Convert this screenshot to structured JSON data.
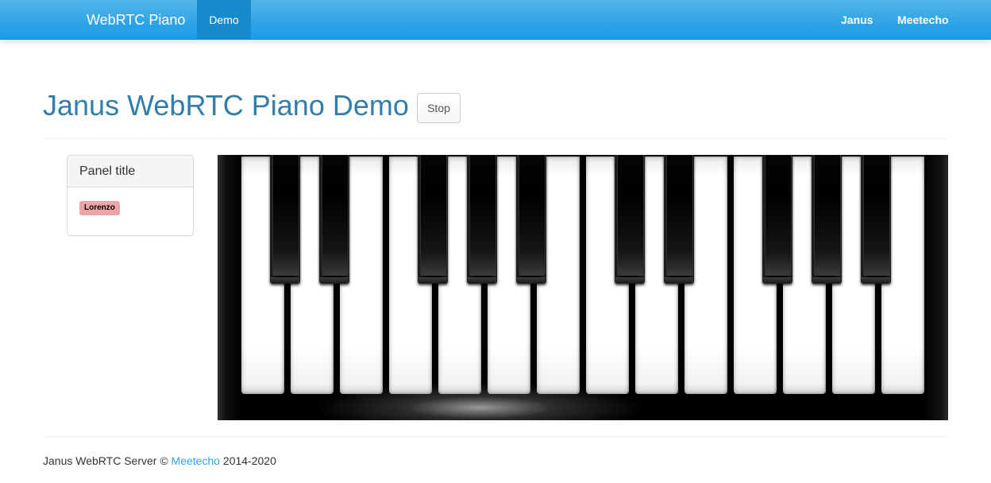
{
  "navbar": {
    "brand": "WebRTC Piano",
    "active_item": "Demo",
    "right_items": [
      "Janus",
      "Meetecho"
    ],
    "background_color": "#2fa4e7",
    "active_color": "#178acc"
  },
  "header": {
    "title": "Janus WebRTC Piano Demo",
    "stop_label": "Stop",
    "title_color": "#317eac"
  },
  "panel": {
    "title": "Panel title",
    "participants": [
      "Lorenzo"
    ],
    "participant_label_color": "#eba5a8"
  },
  "piano": {
    "white_key_count": 14,
    "black_key_count": 10
  },
  "footer": {
    "prefix": "Janus WebRTC Server © ",
    "link": "Meetecho",
    "suffix": " 2014-2020",
    "link_color": "#2fa4e7"
  }
}
